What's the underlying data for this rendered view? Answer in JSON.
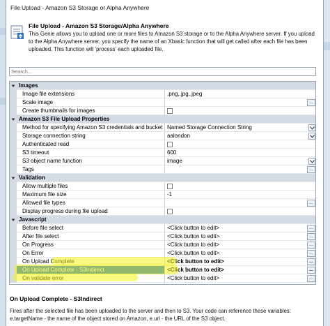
{
  "window": {
    "title": "File Upload - Amazon S3 Storage or Alpha Anywhere"
  },
  "header": {
    "title": "File Upload - Amazon S3 Storage/Alpha Anywhere",
    "description": "This Genie allows you to upload one or more files to Amazon S3 storage or to the Alpha Anywhere server. If you upload to the Alpha Anywhere server, you specify the name of an Xbasic function that will get called after each file has been uploaded. This function will 'process' each uploaded file."
  },
  "search": {
    "placeholder": "Search..."
  },
  "grid": {
    "rows": [
      {
        "type": "category",
        "name": "Images"
      },
      {
        "type": "prop",
        "name": "Image file extensions",
        "value": ".png,.jpg,.jpeg"
      },
      {
        "type": "prop",
        "name": "Scale image",
        "value": "",
        "button": "..."
      },
      {
        "type": "prop",
        "name": "Create thumbnails for images",
        "checkbox": true
      },
      {
        "type": "category",
        "name": "Amazon S3 File Upload Properties"
      },
      {
        "type": "prop",
        "name": "Method for specifying Amazon S3 credentials and bucket",
        "value": "Named Storage Connection String",
        "dropdown": true
      },
      {
        "type": "prop",
        "name": "Storage connection string",
        "value": "aalondon",
        "dropdown": true
      },
      {
        "type": "prop",
        "name": "Authenticated read",
        "checkbox": true
      },
      {
        "type": "prop",
        "name": "S3 timeout",
        "value": "600"
      },
      {
        "type": "prop",
        "name": "S3 object name function",
        "value": "image",
        "dropdown": true
      },
      {
        "type": "prop",
        "name": "Tags",
        "value": "",
        "button": "..."
      },
      {
        "type": "category",
        "name": "Validation"
      },
      {
        "type": "prop",
        "name": "Allow multiple files",
        "checkbox": true
      },
      {
        "type": "prop",
        "name": "Maximum file size",
        "value": "-1"
      },
      {
        "type": "prop",
        "name": "Allowed file types",
        "value": "",
        "button": "..."
      },
      {
        "type": "prop",
        "name": "Display progress during file upload",
        "checkbox": true
      },
      {
        "type": "category",
        "name": "Javascript"
      },
      {
        "type": "prop",
        "name": "Before file select",
        "value": "<Click button to edit>",
        "button": "..."
      },
      {
        "type": "prop",
        "name": "After file select",
        "value": "<Click button to edit>",
        "button": "..."
      },
      {
        "type": "prop",
        "name": "On Progress",
        "value": "<Click button to edit>",
        "button": "..."
      },
      {
        "type": "prop",
        "name": "On Error",
        "value": "<Click button to edit>",
        "button": "..."
      },
      {
        "type": "prop",
        "name": "On Upload Complete",
        "value": "<Click button to edit>",
        "button": "...",
        "boldValue": true
      },
      {
        "type": "prop",
        "name": "On Upload Complete - S3Indirect",
        "value": "<Click button to edit>",
        "button": "...",
        "selected": true
      },
      {
        "type": "prop",
        "name": "On validate error",
        "value": "<Click button to edit>",
        "button": "..."
      }
    ]
  },
  "help": {
    "title": "On Upload Complete - S3Indirect",
    "text": "Fires after the selected file has been uploaded to the server and then to S3. Your code can reference these variables: e.targetName - the name of the object stored on Amazon, e.url - the URL of the S3 object."
  },
  "colors": {
    "selection": "#1a72d1",
    "highlighter": "#f4f21a",
    "category_bg": "#d4dbe5"
  }
}
